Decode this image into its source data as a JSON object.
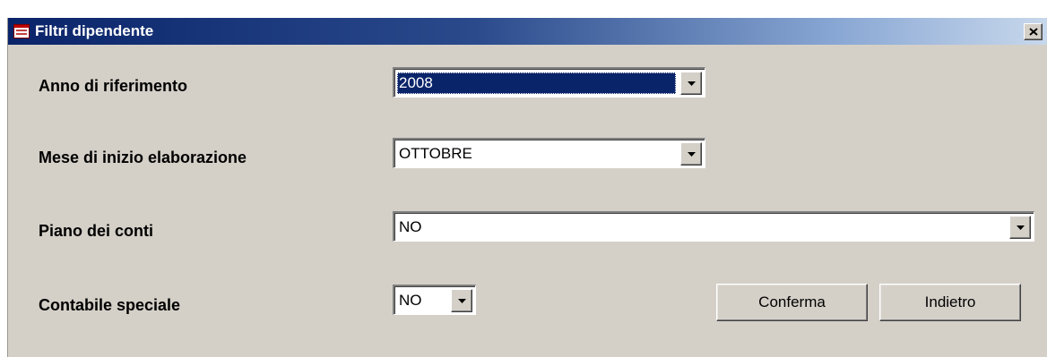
{
  "window": {
    "title": "Filtri dipendente",
    "close_label": "×"
  },
  "fields": {
    "anno": {
      "label": "Anno di riferimento",
      "value": "2008"
    },
    "mese": {
      "label": "Mese di inizio elaborazione",
      "value": "OTTOBRE"
    },
    "piano": {
      "label": "Piano dei conti",
      "value": "NO"
    },
    "contabile": {
      "label": "Contabile speciale",
      "value": "NO"
    }
  },
  "buttons": {
    "confirm": "Conferma",
    "back": "Indietro"
  },
  "colors": {
    "titlebar_start": "#0a246a",
    "titlebar_end": "#c8d8ec",
    "dialog_face": "#d4d0c8",
    "selection": "#0a246a"
  },
  "icons": {
    "title": "form-icon",
    "close": "close-icon",
    "dropdown": "chevron-down-icon"
  }
}
